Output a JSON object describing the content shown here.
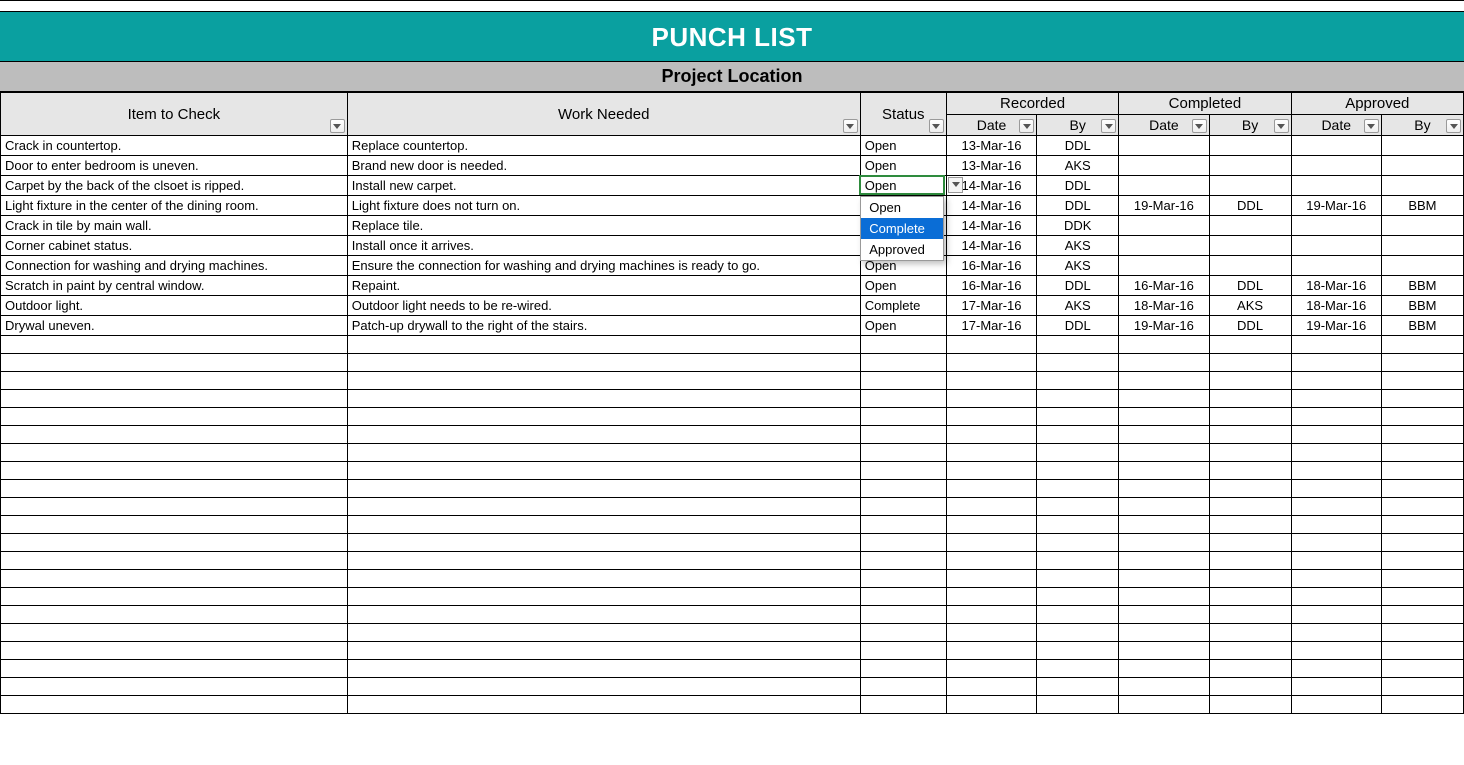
{
  "title": "PUNCH LIST",
  "subtitle": "Project Location",
  "headers": {
    "item": "Item to Check",
    "work": "Work Needed",
    "status": "Status",
    "recorded": "Recorded",
    "completed": "Completed",
    "approved": "Approved",
    "date": "Date",
    "by": "By"
  },
  "dropdown": {
    "options": [
      "Open",
      "Complete",
      "Approved"
    ],
    "selected_index": 1
  },
  "active_status_cell_value": "Open",
  "rows": [
    {
      "item": "Crack in countertop.",
      "work": "Replace countertop.",
      "status": "Open",
      "rec_date": "13-Mar-16",
      "rec_by": "DDL",
      "comp_date": "",
      "comp_by": "",
      "appr_date": "",
      "appr_by": ""
    },
    {
      "item": "Door to enter bedroom is uneven.",
      "work": "Brand new door is needed.",
      "status": "Open",
      "rec_date": "13-Mar-16",
      "rec_by": "AKS",
      "comp_date": "",
      "comp_by": "",
      "appr_date": "",
      "appr_by": ""
    },
    {
      "item": "Carpet by the back of the clsoet is ripped.",
      "work": "Install new carpet.",
      "status": "Open",
      "rec_date": "14-Mar-16",
      "rec_by": "DDL",
      "comp_date": "",
      "comp_by": "",
      "appr_date": "",
      "appr_by": ""
    },
    {
      "item": "Light fixture in the center of the dining room.",
      "work": "Light fixture does not turn on.",
      "status": "",
      "rec_date": "14-Mar-16",
      "rec_by": "DDL",
      "comp_date": "19-Mar-16",
      "comp_by": "DDL",
      "appr_date": "19-Mar-16",
      "appr_by": "BBM"
    },
    {
      "item": "Crack in tile by main wall.",
      "work": "Replace tile.",
      "status": "",
      "rec_date": "14-Mar-16",
      "rec_by": "DDK",
      "comp_date": "",
      "comp_by": "",
      "appr_date": "",
      "appr_by": ""
    },
    {
      "item": "Corner cabinet status.",
      "work": "Install once it arrives.",
      "status": "",
      "rec_date": "14-Mar-16",
      "rec_by": "AKS",
      "comp_date": "",
      "comp_by": "",
      "appr_date": "",
      "appr_by": ""
    },
    {
      "item": "Connection for washing and drying machines.",
      "work": "Ensure the connection for washing and drying machines is ready to go.",
      "status": "Open",
      "rec_date": "16-Mar-16",
      "rec_by": "AKS",
      "comp_date": "",
      "comp_by": "",
      "appr_date": "",
      "appr_by": ""
    },
    {
      "item": "Scratch in paint by central window.",
      "work": "Repaint.",
      "status": "Open",
      "rec_date": "16-Mar-16",
      "rec_by": "DDL",
      "comp_date": "16-Mar-16",
      "comp_by": "DDL",
      "appr_date": "18-Mar-16",
      "appr_by": "BBM"
    },
    {
      "item": "Outdoor light.",
      "work": "Outdoor light needs to be re-wired.",
      "status": "Complete",
      "rec_date": "17-Mar-16",
      "rec_by": "AKS",
      "comp_date": "18-Mar-16",
      "comp_by": "AKS",
      "appr_date": "18-Mar-16",
      "appr_by": "BBM"
    },
    {
      "item": "Drywal uneven.",
      "work": "Patch-up drywall to the right of the stairs.",
      "status": "Open",
      "rec_date": "17-Mar-16",
      "rec_by": "DDL",
      "comp_date": "19-Mar-16",
      "comp_by": "DDL",
      "appr_date": "19-Mar-16",
      "appr_by": "BBM"
    }
  ],
  "empty_rows": 21
}
